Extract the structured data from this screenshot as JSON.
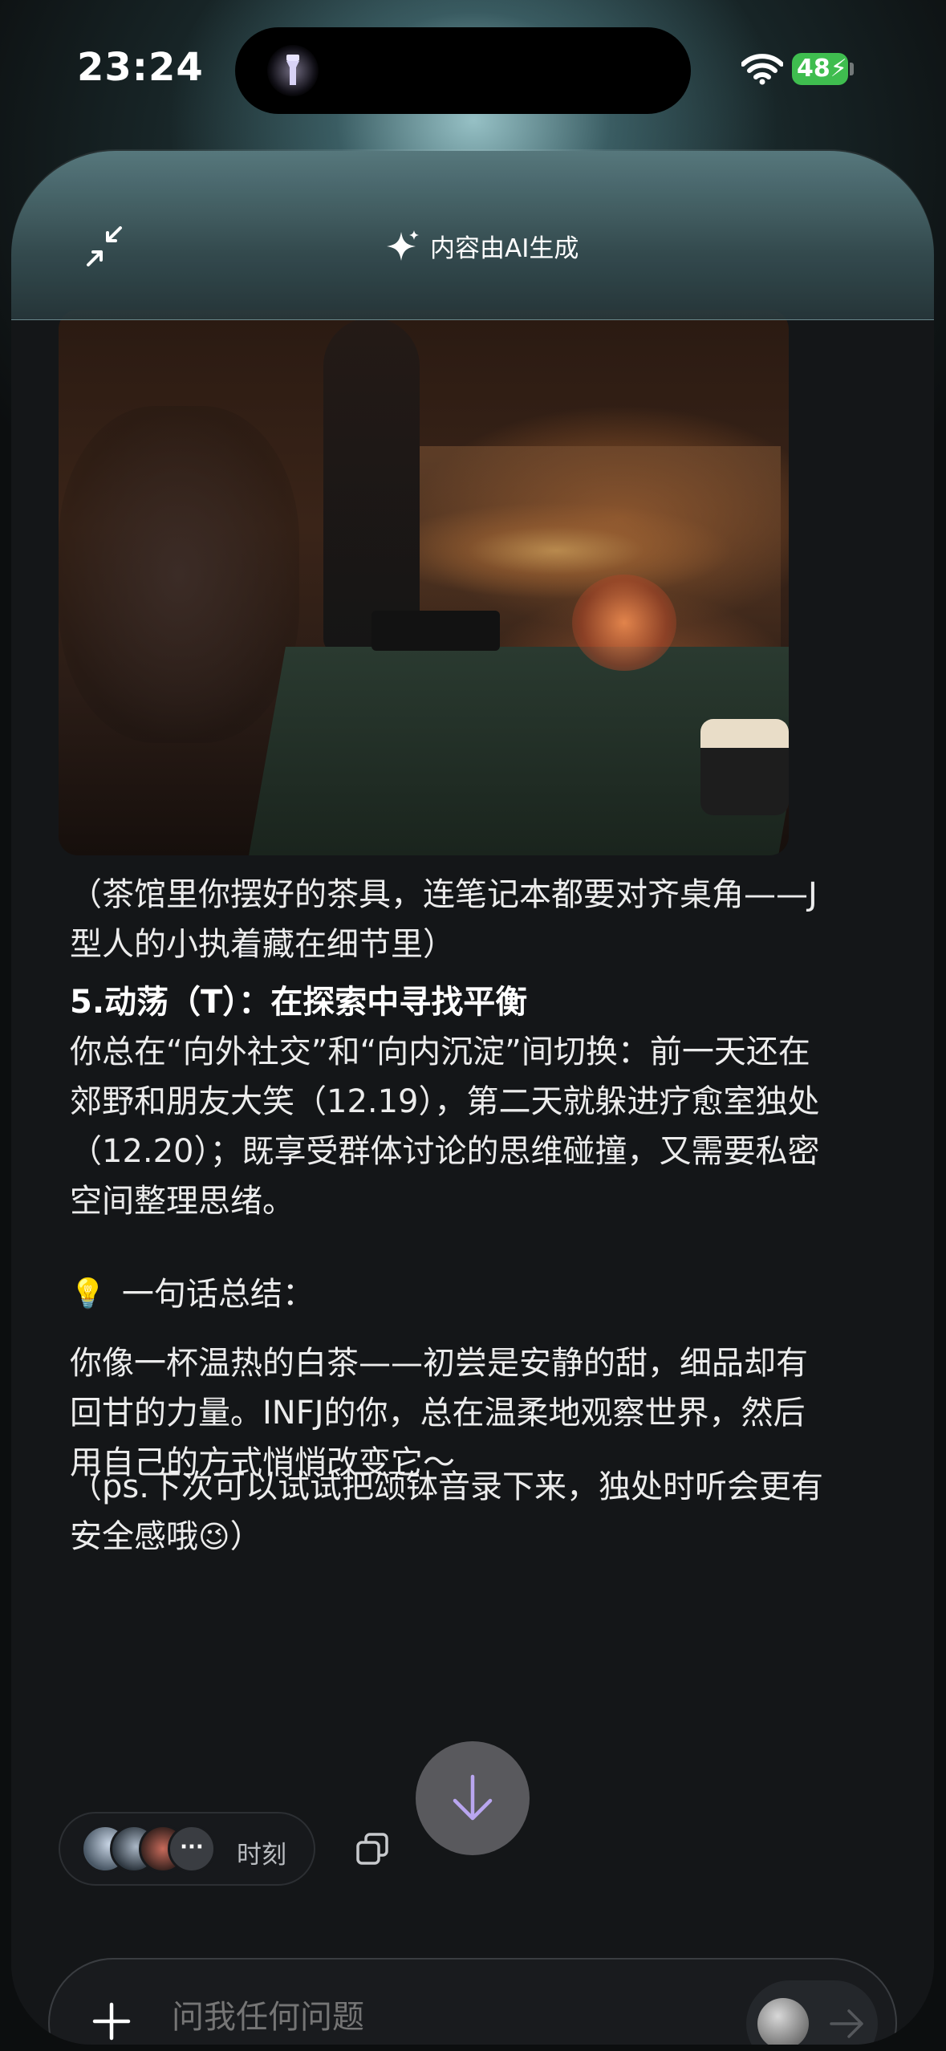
{
  "status_bar": {
    "time": "23:24",
    "battery": "48"
  },
  "header": {
    "ai_label": "内容由AI生成"
  },
  "content": {
    "caption": "（茶馆里你摆好的茶具，连笔记本都要对齐桌角——J型人的小执着藏在细节里）",
    "section_title": "5.动荡（T）：在探索中寻找平衡",
    "section_body": "你总在“向外社交”和“向内沉淀”间切换：前一天还在郊野和朋友大笑（12.19），第二天就躲进疗愈室独处（12.20）；既享受群体讨论的思维碰撞，又需要私密空间整理思绪。",
    "summary_heading": "一句话总结：",
    "summary_body": "你像一杯温热的白茶——初尝是安静的甜，细品却有回甘的力量。INFJ的你，总在温柔地观察世界，然后用自己的方式悄悄改变它～",
    "ps_text": "（ps.下次可以试试把颂钵音录下来，独处时听会更有安全感哦",
    "ps_emoji": "😉",
    "ps_end": "）"
  },
  "moments": {
    "more": "···",
    "label": "时刻"
  },
  "composer": {
    "placeholder": "问我任何问题"
  },
  "icons": {
    "collapse": "collapse-icon",
    "sparkle": "sparkle-icon",
    "bulb": "💡",
    "arrow_down": "arrow-down-icon",
    "copy": "copy-icon",
    "plus": "plus-icon",
    "send": "arrow-right-icon"
  },
  "colors": {
    "accent_arrow": "#b9a6f0",
    "battery": "#3fbd4f"
  }
}
